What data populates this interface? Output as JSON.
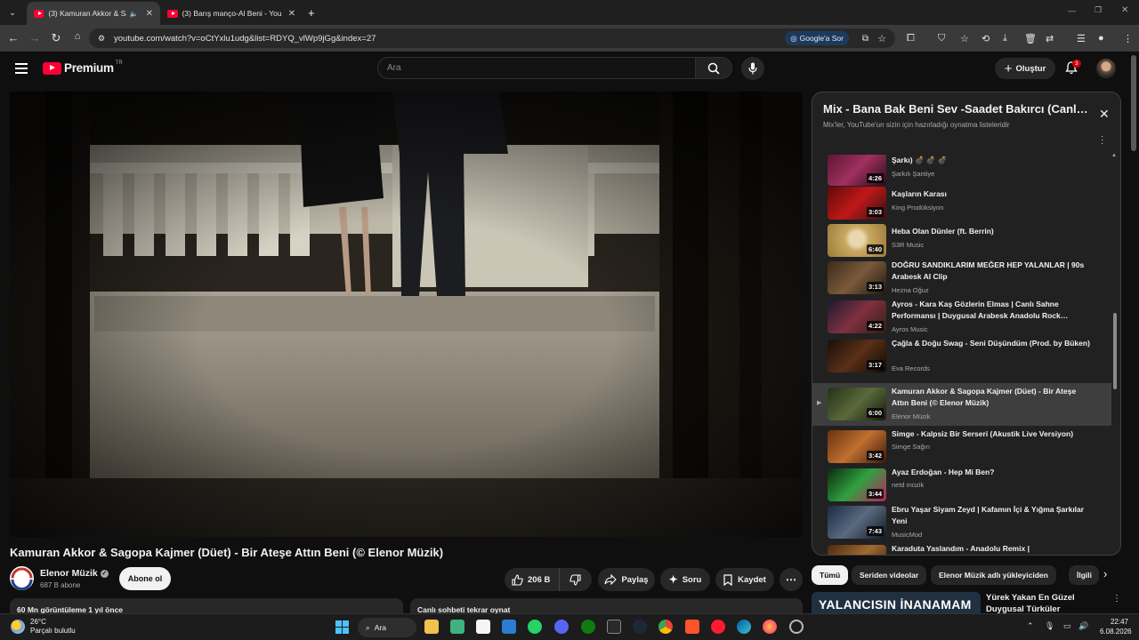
{
  "browser": {
    "tabs": [
      {
        "title": "(3) Kamuran Akkor & Sagopa Kajmer",
        "active": true
      },
      {
        "title": "(3) Barış manço-Al Beni - YouTube",
        "active": false
      }
    ],
    "url": "youtube.com/watch?v=oCtYxlu1udg&list=RDYQ_vlWp9jGg&index=27",
    "google_ask": "Google'a Sor"
  },
  "header": {
    "logo_text": "Premium",
    "logo_sup": "TR",
    "search_placeholder": "Ara",
    "create_label": "Oluştur",
    "notification_count": "3"
  },
  "video": {
    "title": "Kamuran Akkor & Sagopa Kajmer (Düet) - Bir Ateşe Attın Beni (© Elenor Müzik)",
    "channel": "Elenor Müzik",
    "subscribers": "687 B abone",
    "subscribe_label": "Abone ol",
    "likes": "206 B",
    "share_label": "Paylaş",
    "ask_label": "Soru",
    "save_label": "Kaydet",
    "views_partial": "60 Mn görüntüleme 1 yıl önce",
    "chat_partial": "Canlı sohbeti tekrar oynat"
  },
  "playlist": {
    "title": "Mix - Bana Bak Beni Sev -Saadet Bakırcı (Canlı Performans)",
    "subtitle": "Mix'ler, YouTube'un sizin için hazırladığı oynatma listeleridir",
    "items": [
      {
        "title": "Şarkı) 💣 💣 💣",
        "channel": "Şarkılı Şantiye",
        "duration": "4:26"
      },
      {
        "title": "Kaşların Karası",
        "channel": "King Prodüksiyon",
        "duration": "3:03"
      },
      {
        "title": "Heba Olan Dünler (ft. Berrin)",
        "channel": "S3R Music",
        "duration": "6:40"
      },
      {
        "title": "DOĞRU SANDIKLARIM MEĞER HEP YALANLAR | 90s Arabesk AI Clip",
        "channel": "Hezna Oğuz",
        "duration": "3:13"
      },
      {
        "title": "Ayros - Kara Kaş Gözlerin Elmas | Canlı Sahne Performansı | Duygusal Arabesk Anadolu Rock…",
        "channel": "Ayros Music",
        "duration": "4:22"
      },
      {
        "title": "Çağla & Doğu Swag - Seni Düşündüm (Prod. by Büken)",
        "channel": "Eva Records",
        "duration": "3:17"
      },
      {
        "title": "Kamuran Akkor & Sagopa Kajmer (Düet) - Bir Ateşe Attın Beni (© Elenor Müzik)",
        "channel": "Elenor Müzik",
        "duration": "6:00",
        "current": true
      },
      {
        "title": "Simge - Kalpsiz Bir Serseri (Akustik Live Versiyon)",
        "channel": "Simge Sağın",
        "duration": "3:42"
      },
      {
        "title": "Ayaz Erdoğan - Hep Mi Ben?",
        "channel": "netd müzik",
        "duration": "3:44"
      },
      {
        "title": "Ebru Yaşar Siyam Zeyd | Kafamın İçi & Yığma Şarkılar Yeni",
        "channel": "MusicMod",
        "duration": "7:43"
      },
      {
        "title": "Karaduta Yaslandım - Anadolu Remix |",
        "channel": "",
        "duration": ""
      }
    ]
  },
  "chips": [
    "Tümü",
    "Seriden videolar",
    "Elenor Müzik adlı yükleyiciden",
    "İlgili"
  ],
  "recommendation": {
    "thumb_text": "YALANCISIN İNANAMAM",
    "title": "Yürek Yakan En Güzel Duygusal Türküler"
  },
  "taskbar": {
    "temperature": "26°C",
    "weather": "Parçalı bulutlu",
    "search_label": "Ara",
    "time": "22:47",
    "date": "6.08.2026"
  },
  "colors": {
    "brand_red": "#ff0033",
    "background": "#0f0f0f",
    "panel": "#212121"
  }
}
